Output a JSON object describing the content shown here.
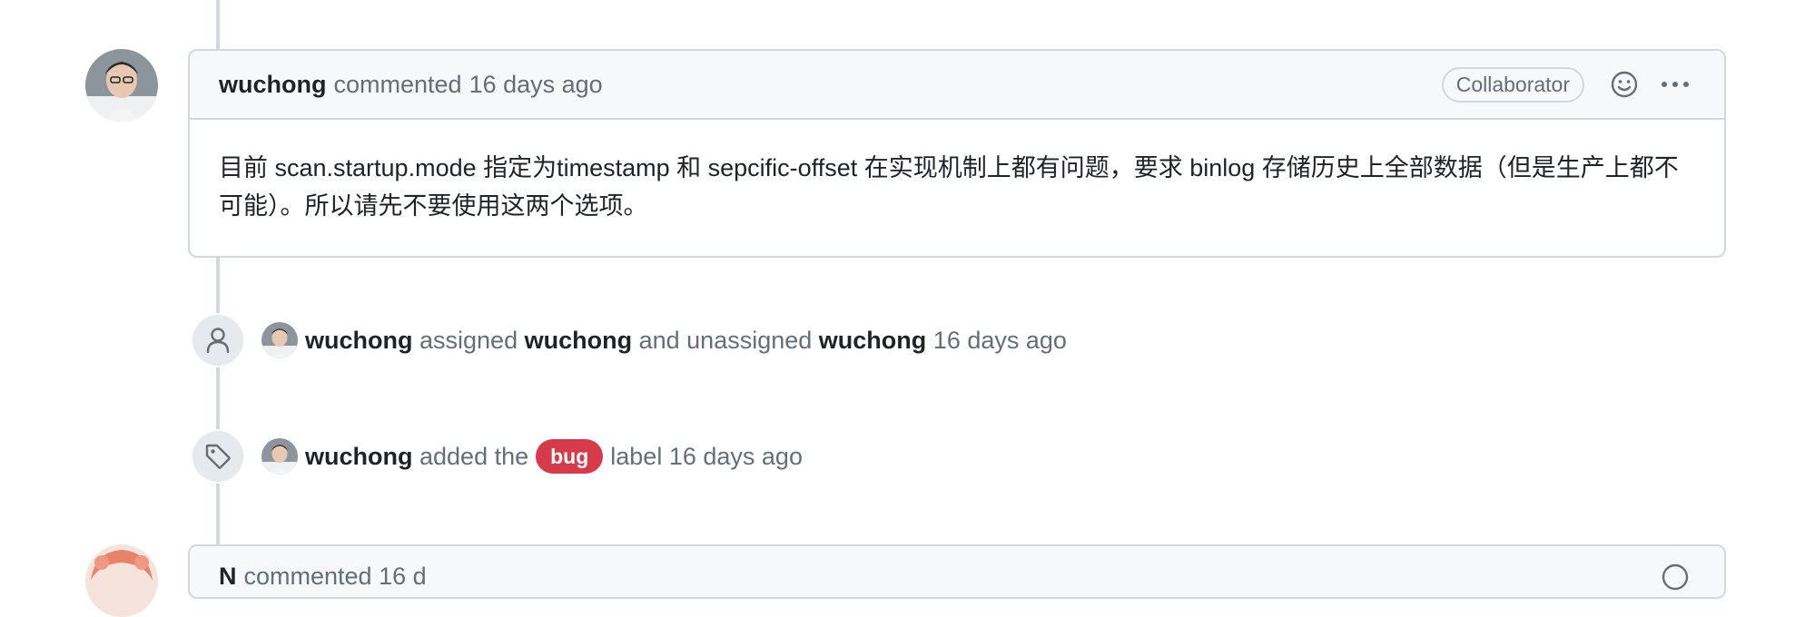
{
  "comment": {
    "author": "wuchong",
    "action": "commented",
    "time": "16 days ago",
    "role_badge": "Collaborator",
    "body": "目前 scan.startup.mode 指定为timestamp 和 sepcific-offset 在实现机制上都有问题，要求 binlog 存储历史上全部数据（但是生产上都不可能）。所以请先不要使用这两个选项。",
    "reaction_icon": "smiley-icon",
    "menu_icon": "kebab-horizontal-icon"
  },
  "events": [
    {
      "icon": "person-icon",
      "actor": "wuchong",
      "verb": "assigned",
      "target": "wuchong",
      "connector": "and unassigned",
      "target2": "wuchong",
      "time": "16 days ago"
    },
    {
      "icon": "tag-icon",
      "actor": "wuchong",
      "verb": "added the",
      "label": "bug",
      "suffix": "label",
      "time": "16 days ago",
      "label_color": "#d73a4a"
    }
  ],
  "next_comment": {
    "author_partial": "N",
    "partial_text": "commented 16 d"
  },
  "colors": {
    "border": "#d0d7de",
    "header_bg": "#f6f8fa",
    "muted": "#656d76",
    "text": "#1f2328"
  }
}
